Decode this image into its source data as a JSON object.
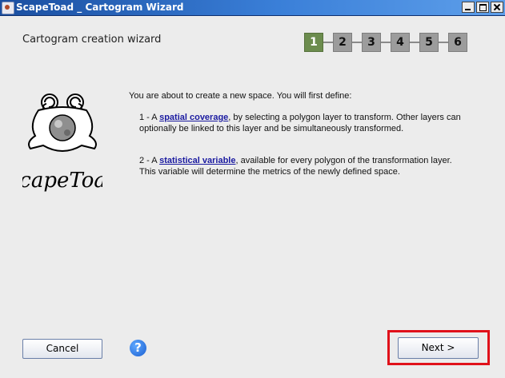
{
  "window": {
    "title": "ScapeToad _ Cartogram Wizard",
    "controls": [
      "minimize-icon",
      "maximize-icon",
      "close-icon"
    ]
  },
  "wizard": {
    "title": "Cartogram creation wizard",
    "steps": [
      "1",
      "2",
      "3",
      "4",
      "5",
      "6"
    ],
    "current_step": "1"
  },
  "logo": {
    "text": "ScapeToad"
  },
  "content": {
    "intro": "You are about to create a new space. You will first define:",
    "item1": {
      "prefix": "1 - A ",
      "link": "spatial coverage",
      "suffix": ", by selecting a polygon layer to transform. Other layers can optionally be linked to this layer and be simultaneously transformed."
    },
    "item2": {
      "prefix": "2 - A ",
      "link": "statistical variable",
      "suffix": ", available for every polygon of the transformation layer. This variable will determine the metrics of the newly defined space."
    }
  },
  "buttons": {
    "cancel": "Cancel",
    "help_icon": "question-mark-icon",
    "next": "Next >"
  },
  "colors": {
    "active_step": "#6c8c4e",
    "inactive_step": "#9c9c9c",
    "highlight": "#e0111a",
    "link": "#1a1aa0"
  }
}
